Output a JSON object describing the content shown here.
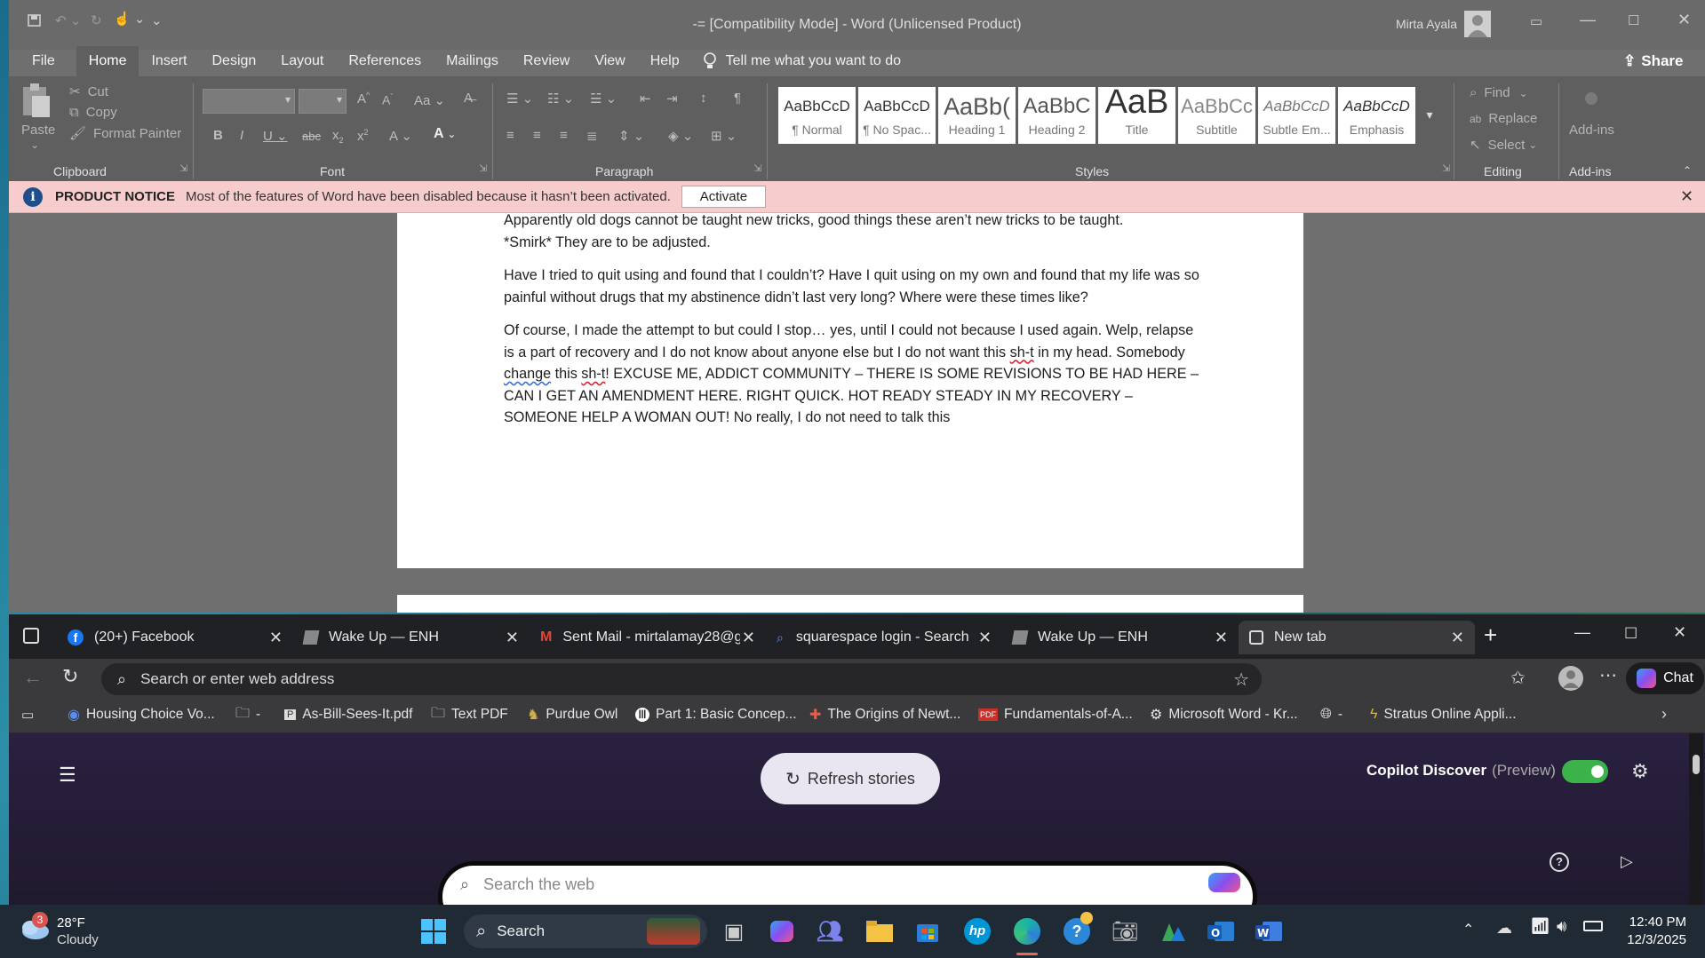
{
  "word": {
    "title": "-= [Compatibility Mode]  -  Word (Unlicensed Product)",
    "user": "Mirta Ayala",
    "share": "Share",
    "tabs": [
      "File",
      "Home",
      "Insert",
      "Design",
      "Layout",
      "References",
      "Mailings",
      "Review",
      "View",
      "Help"
    ],
    "tell_me": "Tell me what you want to do",
    "clipboard": {
      "paste": "Paste",
      "cut": "Cut",
      "copy": "Copy",
      "format_painter": "Format Painter",
      "label": "Clipboard"
    },
    "font_label": "Font",
    "paragraph_label": "Paragraph",
    "styles": [
      {
        "preview": "AaBbCcD",
        "name": "¶ Normal"
      },
      {
        "preview": "AaBbCcD",
        "name": "¶ No Spac..."
      },
      {
        "preview": "AaBb(",
        "name": "Heading 1"
      },
      {
        "preview": "AaBbC",
        "name": "Heading 2"
      },
      {
        "preview": "AaB",
        "name": "Title"
      },
      {
        "preview": "AaBbCc",
        "name": "Subtitle"
      },
      {
        "preview": "AaBbCcD",
        "name": "Subtle Em..."
      },
      {
        "preview": "AaBbCcD",
        "name": "Emphasis"
      }
    ],
    "styles_label": "Styles",
    "editing": {
      "find": "Find",
      "replace": "Replace",
      "select": "Select",
      "label": "Editing"
    },
    "addins": {
      "button": "Add-ins",
      "label": "Add-ins"
    },
    "notice": {
      "title": "PRODUCT NOTICE",
      "text": "Most of the features of Word have been disabled because it hasn’t been activated.",
      "button": "Activate"
    },
    "doc": {
      "p1_l1": "Apparently old dogs cannot be taught new tricks, good things these aren’t new tricks to be taught.",
      "p1_l2": "*Smirk* They are to be adjusted.",
      "p2": "Have I tried to quit using and found that I couldn’t? Have I quit using on my own and found that my life was so painful without drugs that my abstinence didn’t last very long? Where were these times like?",
      "p3_a": "Of course, I made the attempt to but could I stop… yes, until I could not because I used again. Welp, relapse is a part of recovery and I do not know about anyone else but I do not want this ",
      "p3_sh1": "sh-t",
      "p3_b": " in my head. Somebody ",
      "p3_change": "change",
      "p3_c": " this ",
      "p3_sh2": "sh-t",
      "p3_d": "! EXCUSE ME, ADDICT COMMUNITY – THERE IS SOME REVISIONS TO BE HAD HERE – CAN I GET AN AMENDMENT HERE. RIGHT QUICK. HOT READY STEADY IN MY RECOVERY – SOMEONE HELP A WOMAN OUT! No really, I do not need to talk this"
    }
  },
  "edge": {
    "tabs": [
      {
        "title": "(20+) Facebook",
        "icon": "facebook-icon"
      },
      {
        "title": "Wake Up — ENH",
        "icon": "page-icon"
      },
      {
        "title": "Sent Mail - mirtalamay28@g",
        "icon": "gmail-icon"
      },
      {
        "title": "squarespace login - Search",
        "icon": "search-icon"
      },
      {
        "title": "Wake Up — ENH",
        "icon": "page-icon"
      },
      {
        "title": "New tab",
        "icon": "newtab-icon"
      }
    ],
    "address_placeholder": "Search or enter web address",
    "chat": "Chat",
    "favorites": [
      "Housing Choice Vo...",
      "-",
      "As-Bill-Sees-It.pdf",
      "Text PDF",
      "Purdue Owl",
      "Part 1: Basic Concep...",
      "The Origins of Newt...",
      "Fundamentals-of-A...",
      "Microsoft Word - Kr...",
      "-",
      "Stratus Online Appli..."
    ],
    "refresh": "Refresh stories",
    "discover": "Copilot Discover",
    "preview": "(Preview)",
    "search_placeholder": "Search the web"
  },
  "taskbar": {
    "weather_temp": "28°F",
    "weather_desc": "Cloudy",
    "weather_badge": "3",
    "search": "Search",
    "time": "12:40 PM",
    "date": "12/3/2025"
  }
}
